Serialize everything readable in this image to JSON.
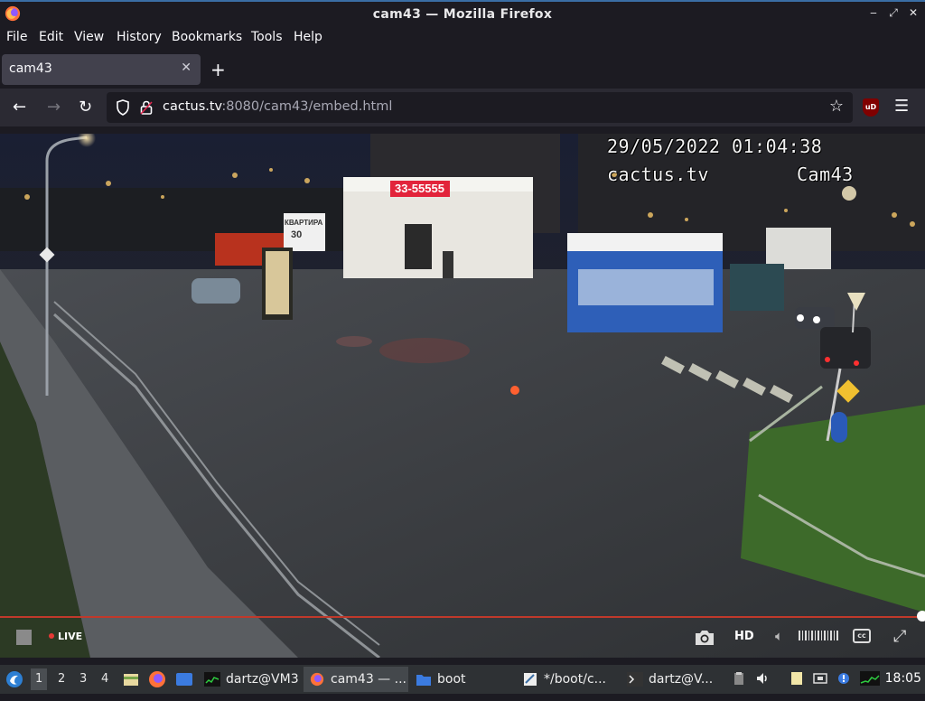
{
  "window": {
    "title": "cam43 — Mozilla Firefox",
    "controls": [
      "‒",
      "⤢",
      "✕"
    ]
  },
  "menu": {
    "items": [
      "File",
      "Edit",
      "View",
      "History",
      "Bookmarks",
      "Tools",
      "Help"
    ]
  },
  "tabs": [
    {
      "label": "cam43",
      "active": true
    }
  ],
  "toolbar": {
    "url_host": "cactus.tv",
    "url_rest": ":8080/cam43/embed.html",
    "extension_label": "uD"
  },
  "video": {
    "osd_datetime": "29/05/2022 01:04:38",
    "osd_site": "cactus.tv",
    "osd_cam": "Cam43",
    "signs": {
      "shop_phone": "33-55555",
      "billboard_main": "КВАРТИРА",
      "billboard_sub": "30"
    },
    "controls": {
      "live_label": "LIVE",
      "quality_label": "HD",
      "cc_label": "cc"
    },
    "progress_fraction": 1.0
  },
  "taskbar": {
    "workspaces": [
      "1",
      "2",
      "3",
      "4"
    ],
    "active_workspace": "1",
    "tasks": [
      {
        "label": "dartz@VM3",
        "icon": "terminal-icon",
        "active": false
      },
      {
        "label": "cam43 — ...",
        "icon": "firefox-icon",
        "active": true
      },
      {
        "label": "boot",
        "icon": "folder-icon",
        "active": false
      },
      {
        "label": "*/boot/c...",
        "icon": "text-editor-icon",
        "active": false
      },
      {
        "label": "dartz@V...",
        "icon": "terminal-icon",
        "active": false
      }
    ],
    "clock": "18:05"
  },
  "colors": {
    "accent": "#3a6ea5",
    "progress": "#c0392b",
    "live_dot": "#e53935"
  }
}
